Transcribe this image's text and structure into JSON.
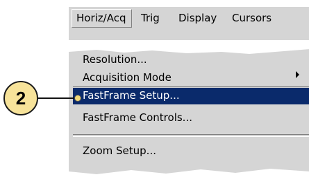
{
  "menubar": {
    "items": [
      {
        "label": "Horiz/Acq"
      },
      {
        "label": "Trig"
      },
      {
        "label": "Display"
      },
      {
        "label": "Cursors"
      }
    ]
  },
  "dropdown": {
    "items": [
      {
        "label": "Resolution..."
      },
      {
        "label": "Acquisition Mode"
      },
      {
        "label": "FastFrame Setup..."
      },
      {
        "label": "FastFrame Controls..."
      },
      {
        "label": "Zoom Setup..."
      }
    ]
  },
  "callout": {
    "number": "2"
  },
  "colors": {
    "menu_bg": "#d5d5d5",
    "highlight": "#0a2a6b",
    "callout_fill": "#f7e39a"
  }
}
